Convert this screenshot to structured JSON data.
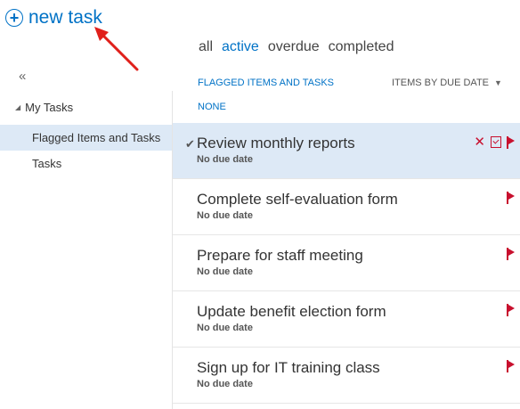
{
  "new_task": {
    "label": "new task",
    "icon": "plus-circle-icon",
    "accent": "#0072c6"
  },
  "annotation": {
    "icon": "red-arrow",
    "color": "#e0201b"
  },
  "filters": {
    "all": "all",
    "active": "active",
    "overdue": "overdue",
    "completed": "completed",
    "selected": "active"
  },
  "sidebar": {
    "collapse": "«",
    "root": {
      "label": "My Tasks",
      "expanded": true
    },
    "items": [
      {
        "label": "Flagged Items and Tasks",
        "selected": true
      },
      {
        "label": "Tasks",
        "selected": false
      }
    ]
  },
  "list_header": {
    "left": "FLAGGED ITEMS AND TASKS",
    "left2": "NONE",
    "sort": "ITEMS BY DUE DATE"
  },
  "tasks": [
    {
      "title": "Review monthly reports",
      "due": "No due date",
      "selected": true
    },
    {
      "title": "Complete self-evaluation form",
      "due": "No due date",
      "selected": false
    },
    {
      "title": "Prepare for staff meeting",
      "due": "No due date",
      "selected": false
    },
    {
      "title": "Update benefit election form",
      "due": "No due date",
      "selected": false
    },
    {
      "title": "Sign up for IT training class",
      "due": "No due date",
      "selected": false
    }
  ],
  "colors": {
    "accent": "#0072c6",
    "flag": "#c8102e",
    "selection": "#dde9f6"
  }
}
